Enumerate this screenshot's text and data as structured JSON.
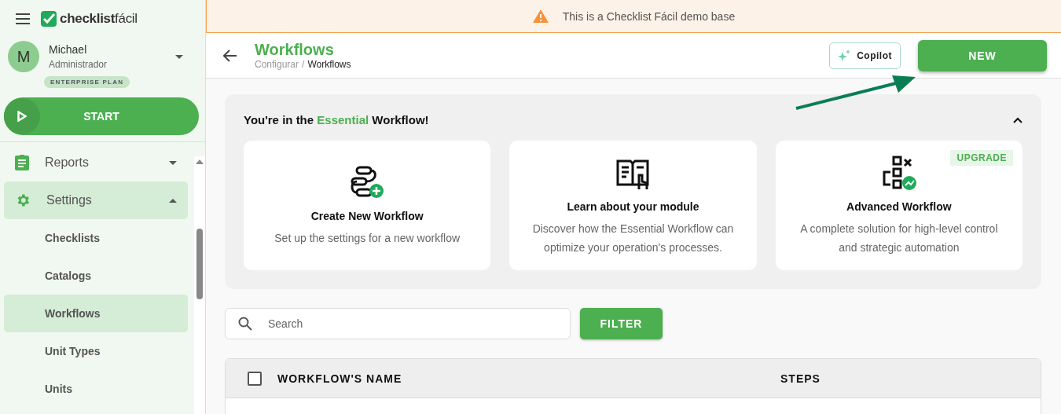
{
  "logo": {
    "text": "checklist",
    "accent": "fácil"
  },
  "user": {
    "initial": "M",
    "name": "Michael",
    "role": "Administrador",
    "plan": "ENTERPRISE PLAN"
  },
  "start_button": "START",
  "nav": [
    {
      "label": "Reports",
      "kind": "report",
      "expanded": false,
      "selected": false
    },
    {
      "label": "Settings",
      "kind": "gear",
      "expanded": true,
      "selected": true,
      "children": [
        {
          "label": "Checklists",
          "selected": false
        },
        {
          "label": "Catalogs",
          "selected": false
        },
        {
          "label": "Workflows",
          "selected": true
        },
        {
          "label": "Unit Types",
          "selected": false
        },
        {
          "label": "Units",
          "selected": false
        }
      ]
    }
  ],
  "banner": "This is a Checklist Fácil demo base",
  "header": {
    "title": "Workflows",
    "breadcrumb": {
      "parent": "Configurar",
      "separator": "/",
      "current": "Workflows"
    },
    "copilot": "Copilot",
    "new": "NEW"
  },
  "promo": {
    "title": "You're in the **Essential** Workflow!",
    "expanded": true,
    "cards": [
      {
        "kind": "create",
        "title": "Create New Workflow",
        "text": "Set up the settings for a new workflow"
      },
      {
        "kind": "book",
        "title": "Learn about your module",
        "text": "Discover how the Essential Workflow can optimize your operation's processes."
      },
      {
        "kind": "advanced",
        "title": "Advanced Workflow",
        "text": "A complete solution for high-level control and strategic automation",
        "badge": "UPGRADE"
      }
    ]
  },
  "search": {
    "placeholder": "Search"
  },
  "filter_button": "FILTER",
  "table": {
    "columns": [
      "WORKFLOW'S NAME",
      "STEPS"
    ],
    "all_checked": false
  }
}
